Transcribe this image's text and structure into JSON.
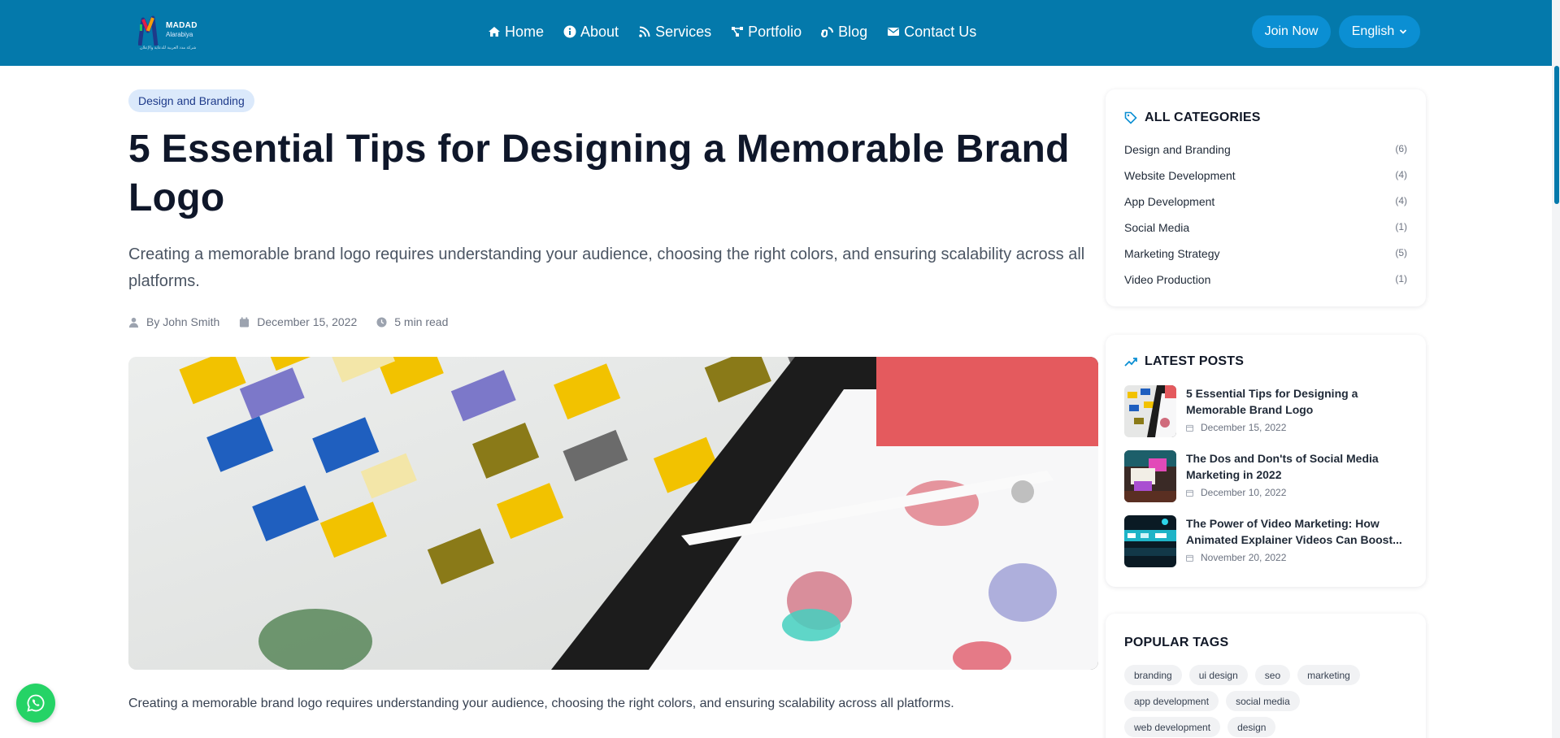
{
  "brand": {
    "name": "MADAD",
    "sub": "Alarabiya",
    "tagline": "شركة مدد العربية للدعاية والإعلان"
  },
  "nav": {
    "items": [
      {
        "label": "Home",
        "icon": "home-icon"
      },
      {
        "label": "About",
        "icon": "info-icon"
      },
      {
        "label": "Services",
        "icon": "rss-icon"
      },
      {
        "label": "Portfolio",
        "icon": "network-icon"
      },
      {
        "label": "Blog",
        "icon": "blog-icon"
      },
      {
        "label": "Contact Us",
        "icon": "envelope-icon"
      }
    ],
    "join_label": "Join Now",
    "language_label": "English"
  },
  "article": {
    "category": "Design and Branding",
    "title": "5 Essential Tips for Designing a Memorable Brand Logo",
    "lead": "Creating a memorable brand logo requires understanding your audience, choosing the right colors, and ensuring scalability across all platforms.",
    "author": "By John Smith",
    "date": "December 15, 2022",
    "read_time": "5 min read",
    "body_first": "Creating a memorable brand logo requires understanding your audience, choosing the right colors, and ensuring scalability across all platforms."
  },
  "sidebar": {
    "categories_title": "ALL CATEGORIES",
    "categories": [
      {
        "name": "Design and Branding",
        "count": "(6)"
      },
      {
        "name": "Website Development",
        "count": "(4)"
      },
      {
        "name": "App Development",
        "count": "(4)"
      },
      {
        "name": "Social Media",
        "count": "(1)"
      },
      {
        "name": "Marketing Strategy",
        "count": "(5)"
      },
      {
        "name": "Video Production",
        "count": "(1)"
      }
    ],
    "latest_title": "LATEST POSTS",
    "latest": [
      {
        "title": "5 Essential Tips for Designing a Memorable Brand Logo",
        "date": "December 15, 2022"
      },
      {
        "title": "The Dos and Don'ts of Social Media Marketing in 2022",
        "date": "December 10, 2022"
      },
      {
        "title": "The Power of Video Marketing: How Animated Explainer Videos Can Boost...",
        "date": "November 20, 2022"
      }
    ],
    "tags_title": "POPULAR TAGS",
    "tags": [
      "branding",
      "ui design",
      "seo",
      "marketing",
      "app development",
      "social media",
      "web development",
      "design"
    ]
  },
  "colors": {
    "navbar": "#0479ab",
    "button": "#0b8fd3",
    "whatsapp": "#25d366"
  }
}
